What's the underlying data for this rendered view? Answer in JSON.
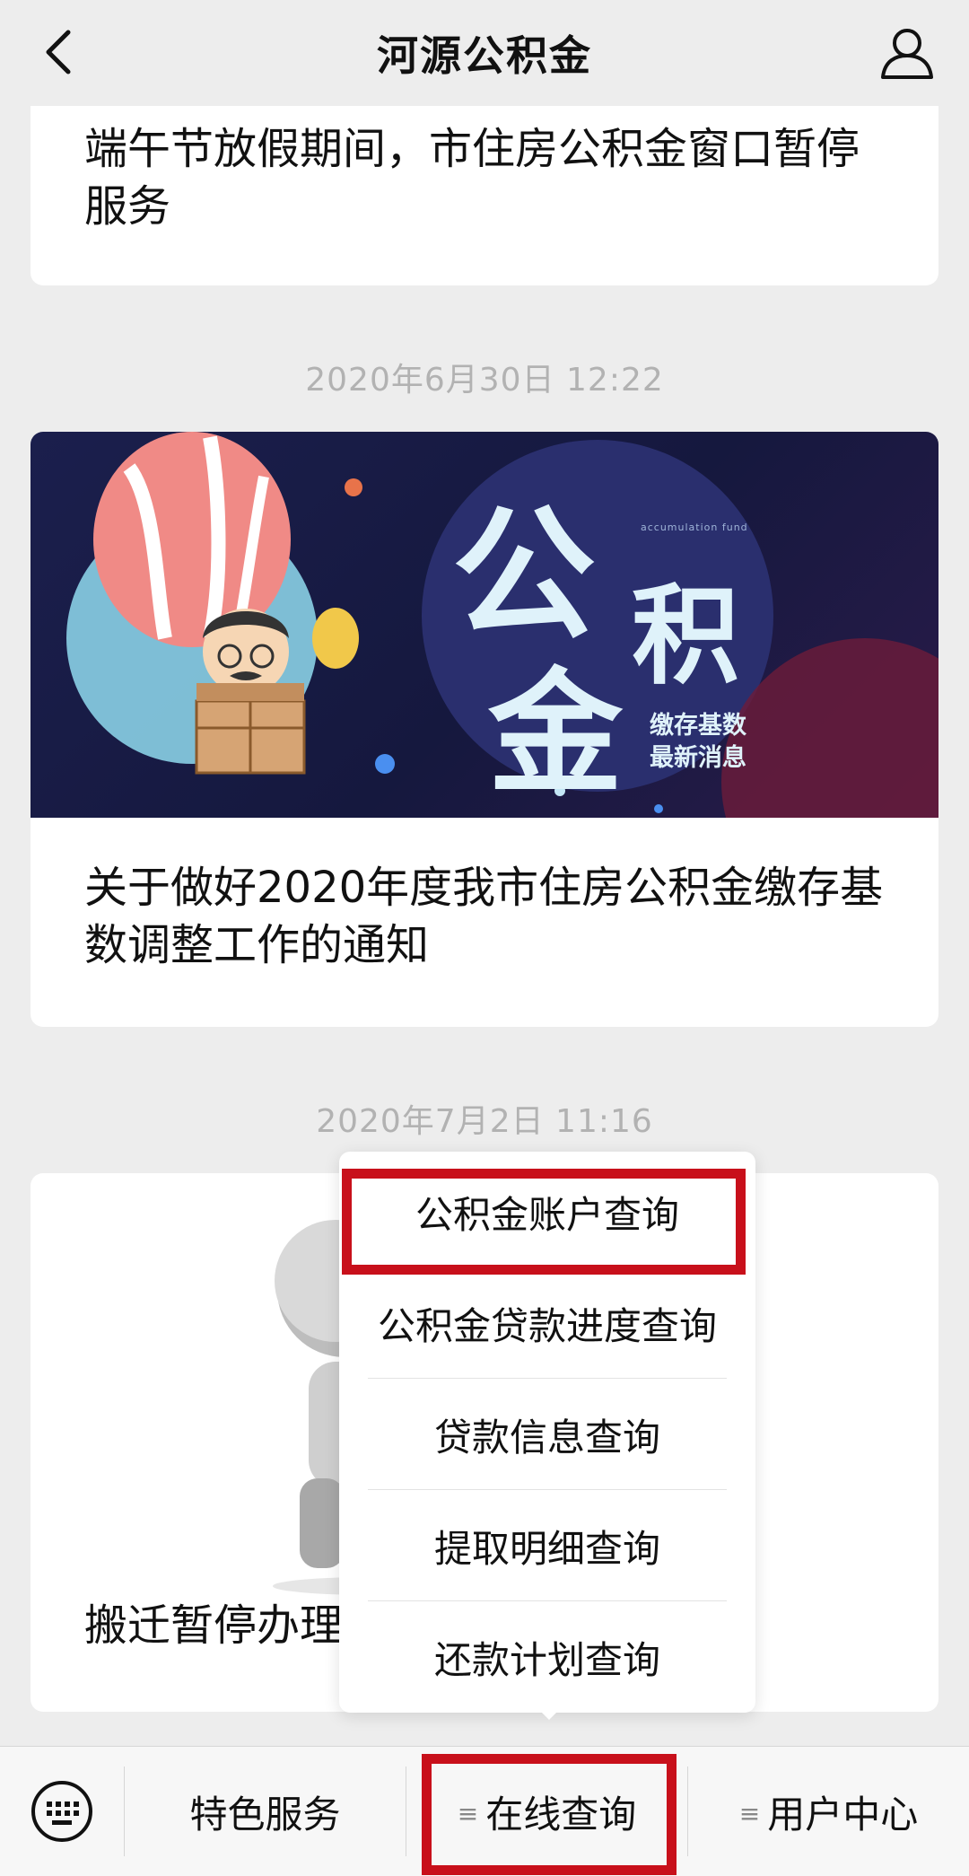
{
  "header": {
    "title": "河源公积金"
  },
  "messages": [
    {
      "title": "端午节放假期间，市住房公积金窗口暂停服务"
    },
    {
      "timestamp": "2020年6月30日 12:22",
      "banner": {
        "big_chars": [
          "公",
          "积",
          "金"
        ],
        "caption_en": "accumulation fund",
        "caption_lines": [
          "缴存基数",
          "最新消息"
        ]
      },
      "title": "关于做好2020年度我市住房公积金缴存基数调整工作的通知"
    },
    {
      "timestamp": "2020年7月2日 11:16",
      "title": "搬迁暂停办理"
    }
  ],
  "popup_menu": {
    "items": [
      "公积金账户查询",
      "公积金贷款进度查询",
      "贷款信息查询",
      "提取明细查询",
      "还款计划查询"
    ]
  },
  "bottom_bar": {
    "items": [
      {
        "label": "特色服务",
        "has_submenu": false
      },
      {
        "label": "在线查询",
        "has_submenu": true
      },
      {
        "label": "用户中心",
        "has_submenu": true
      }
    ]
  },
  "colors": {
    "highlight": "#c8101b",
    "background": "#ededed",
    "timestamp": "#b2b2b2"
  },
  "icons": [
    "back-icon",
    "user-icon",
    "keyboard-icon",
    "menu-glyph"
  ]
}
